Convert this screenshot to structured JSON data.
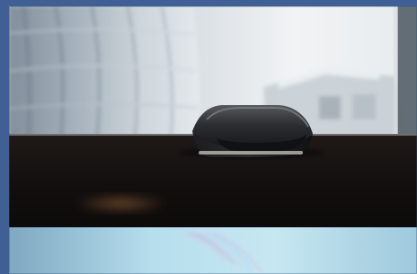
{
  "scene": {
    "subject": "camera-device-on-monitor",
    "background": "blurred-building-and-window",
    "accent_colors": {
      "frame_blue": "#3f5f95",
      "device_dark": "#2a2b2d",
      "monitor_bezel": "#15110f",
      "screen_cyan": "#a9d9e8"
    }
  }
}
